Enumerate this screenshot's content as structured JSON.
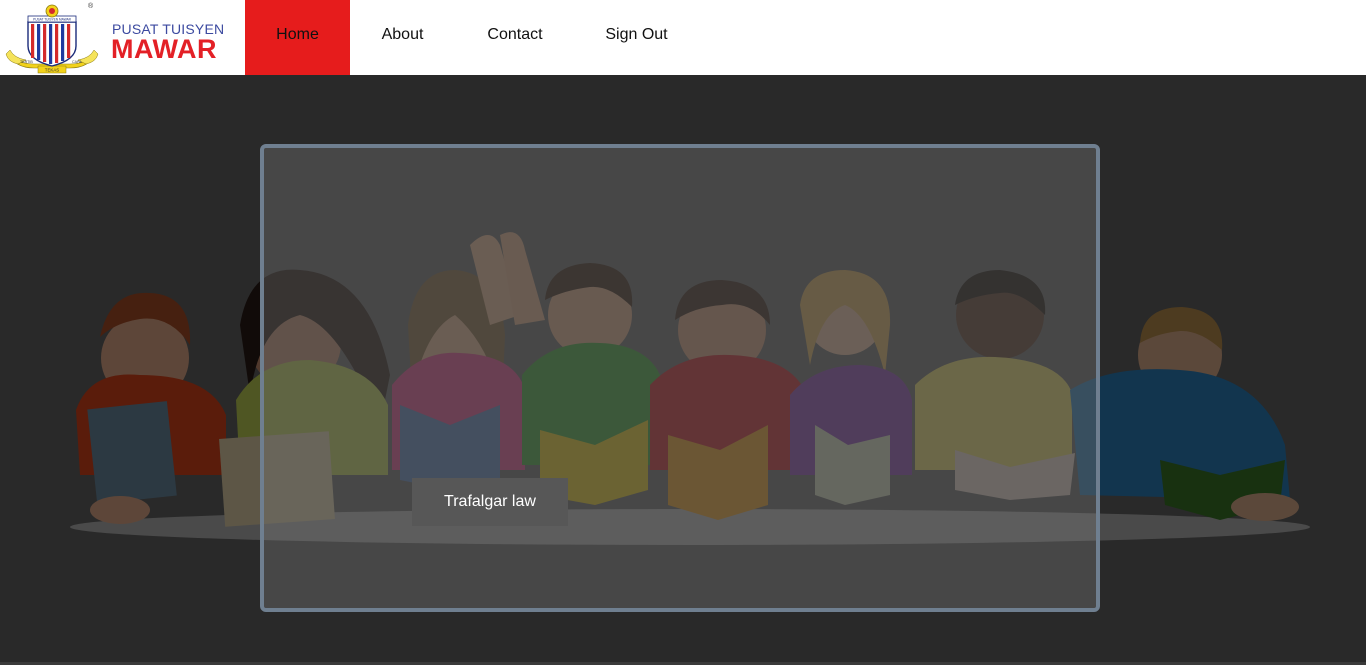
{
  "brand": {
    "line1": "PUSAT TUISYEN",
    "line2": "MAWAR",
    "crest_banner_left": "TERTIB",
    "crest_banner_right": "CAPA",
    "crest_banner_bottom": "TEKAS",
    "crest_top_text": "PUSAT TUISYEN MAWAR",
    "registered_mark": "®"
  },
  "nav": {
    "items": [
      {
        "label": "Home",
        "active": true
      },
      {
        "label": "About",
        "active": false
      },
      {
        "label": "Contact",
        "active": false
      },
      {
        "label": "Sign Out",
        "active": false
      }
    ]
  },
  "hero": {
    "caption_button": "Trafalgar law"
  },
  "colors": {
    "nav_active": "#e61c1c",
    "overlay_bg": "#666666",
    "brand_blue": "#3c4aa0",
    "brand_red": "#e32026",
    "caption_bg": "#575757"
  }
}
